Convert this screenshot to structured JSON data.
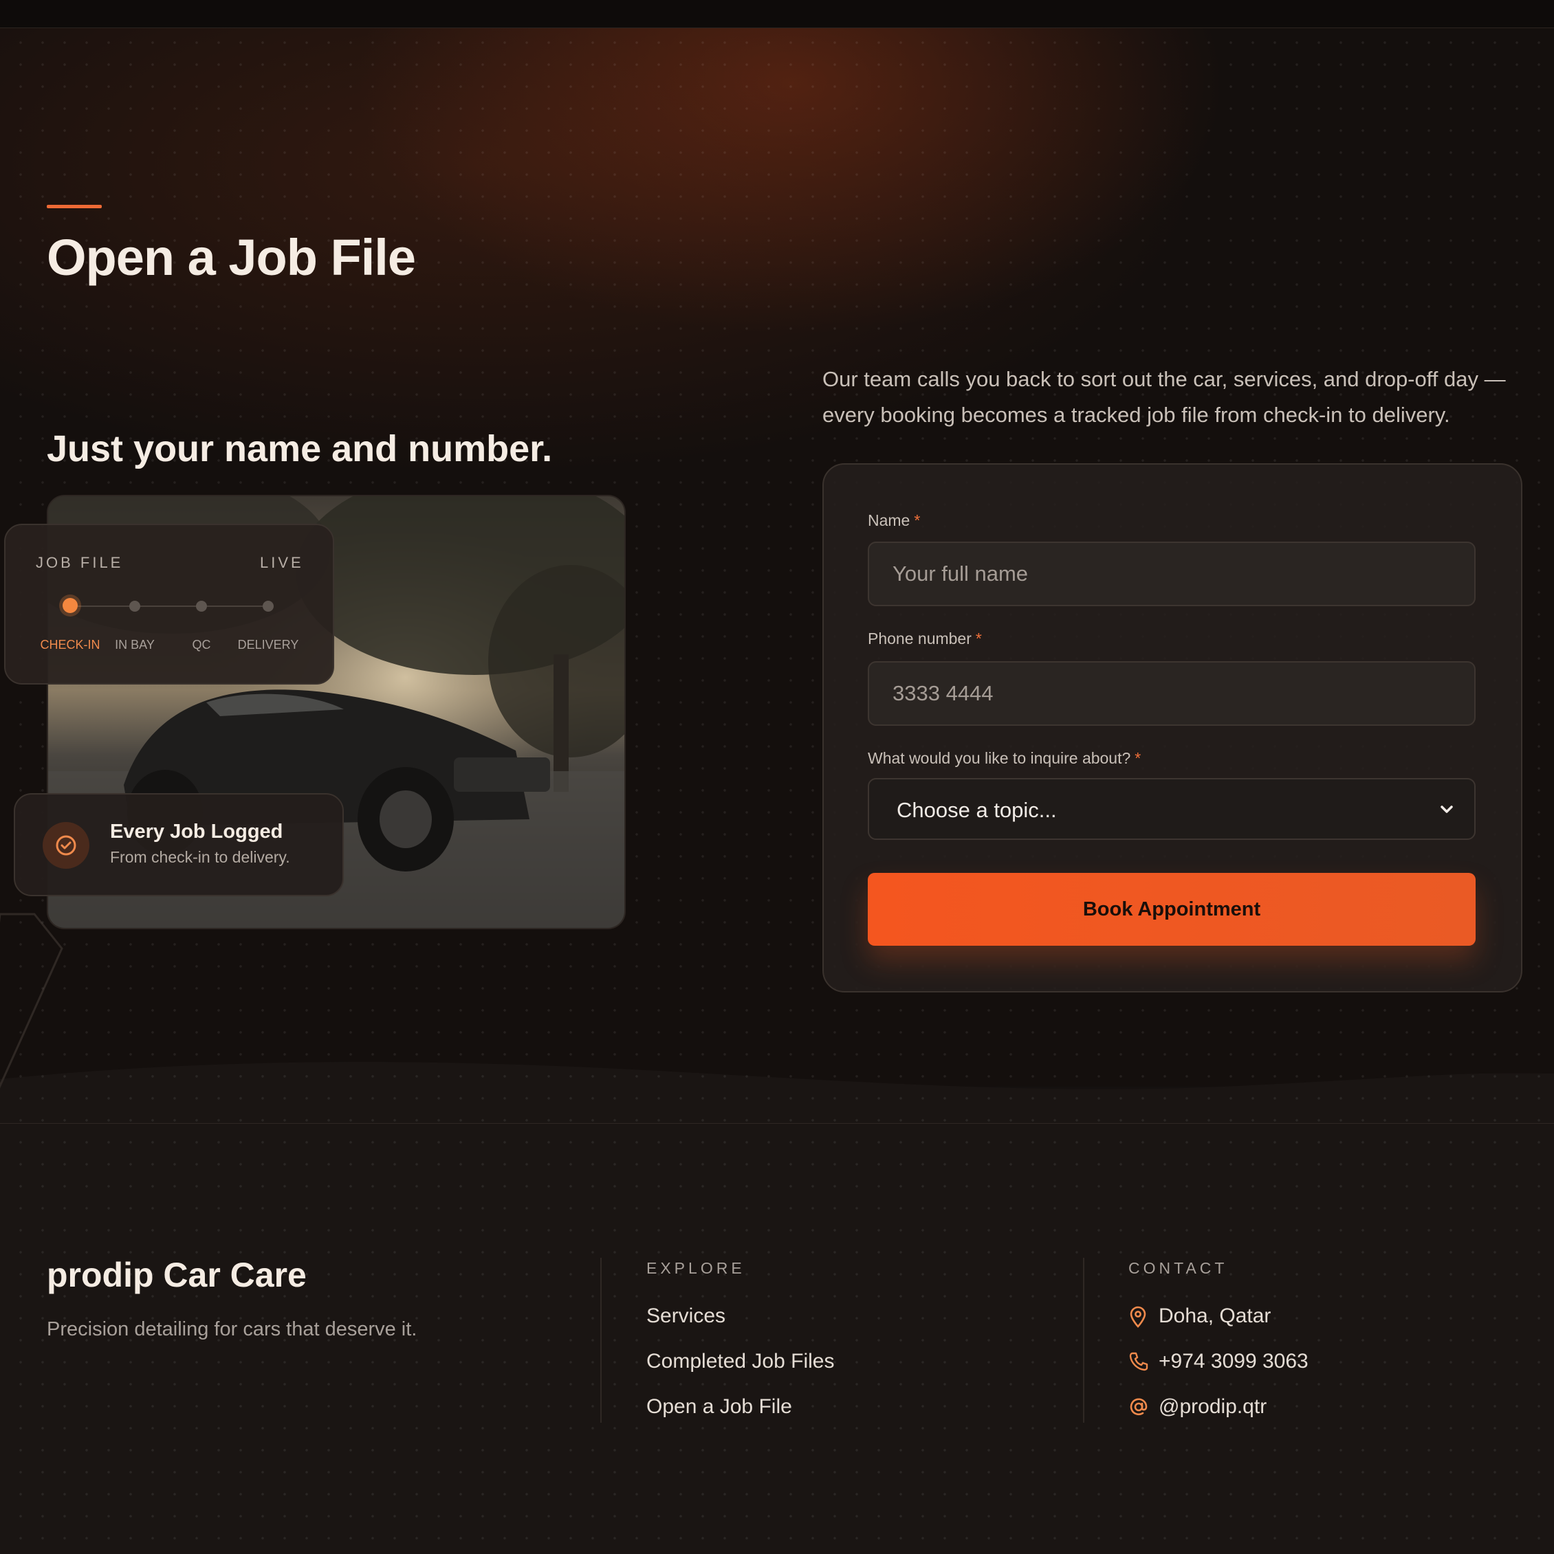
{
  "page": {
    "title": "Open a Job File",
    "subheading": "Just your name and number.",
    "lead": "Our team calls you back to sort out the car, services, and drop-off day — every booking becomes a tracked job file from check-in to delivery."
  },
  "job_card": {
    "label": "JOB FILE",
    "status": "LIVE",
    "steps": [
      "CHECK-IN",
      "IN BAY",
      "QC",
      "DELIVERY"
    ],
    "active_step": 0
  },
  "log_card": {
    "title": "Every Job Logged",
    "subtitle": "From check-in to delivery.",
    "icon": "check-circle-icon"
  },
  "form": {
    "name_label": "Name",
    "name_placeholder": "Your full name",
    "phone_label": "Phone number",
    "phone_placeholder": "3333 4444",
    "topic_label": "What would you like to inquire about?",
    "topic_value": "Choose a topic...",
    "required_mark": "*",
    "submit_label": "Book Appointment"
  },
  "footer": {
    "brand": "prodip Car Care",
    "tagline": "Precision detailing for cars that deserve it.",
    "explore_title": "EXPLORE",
    "explore_links": [
      "Services",
      "Completed Job Files",
      "Open a Job File"
    ],
    "contact_title": "CONTACT",
    "contact": [
      {
        "icon": "map-pin-icon",
        "text": "Doha, Qatar"
      },
      {
        "icon": "phone-icon",
        "text": "+974 3099 3063"
      },
      {
        "icon": "at-sign-icon",
        "text": "@prodip.qtr"
      }
    ]
  },
  "colors": {
    "accent": "#f4561f",
    "accent_soft": "#f08a4c",
    "background": "#151110",
    "card": "#26201d"
  }
}
